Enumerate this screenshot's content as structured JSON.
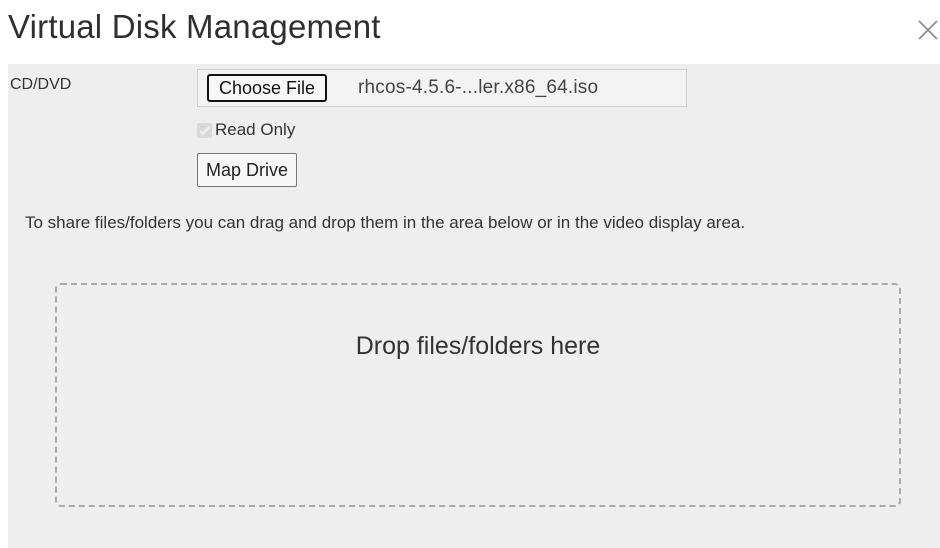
{
  "window": {
    "title": "Virtual Disk Management",
    "close_icon": "close-icon"
  },
  "cd_dvd": {
    "label": "CD/DVD",
    "choose_file_label": "Choose File",
    "selected_file": "rhcos-4.5.6-...ler.x86_64.iso",
    "read_only_label": "Read Only",
    "read_only_checked": true,
    "read_only_enabled": false,
    "map_drive_label": "Map Drive"
  },
  "share": {
    "instructions": "To share files/folders you can drag and drop them in the area below or in the video display area.",
    "drop_zone_label": "Drop files/folders here"
  },
  "colors": {
    "panel_background": "#eeeeee",
    "header_background": "#ffffff",
    "dropzone_border": "#a9a9a9"
  }
}
